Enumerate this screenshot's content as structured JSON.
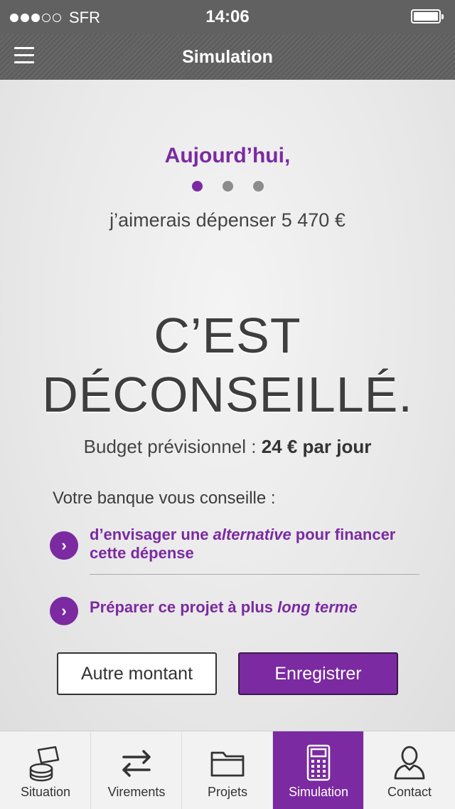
{
  "status_bar": {
    "carrier": "SFR",
    "time": "14:06"
  },
  "nav": {
    "title": "Simulation",
    "menu_icon": "hamburger-icon"
  },
  "simulation": {
    "heading": "Aujourd’hui,",
    "subtitle": "j’aimerais dépenser 5 470 €",
    "verdict_line1": "C’EST",
    "verdict_line2": "DÉCONSEILLÉ.",
    "budget_label": "Budget prévisionnel :",
    "budget_value": "24 € par jour",
    "advice_label": "Votre banque vous conseille :",
    "advice": [
      {
        "part1": "d’envisager une ",
        "italic": "alternative",
        "part2": " pour financer cette dépense"
      },
      {
        "part1": "Préparer ce projet à plus ",
        "italic": "long terme",
        "part2": ""
      }
    ],
    "buttons": {
      "other_amount": "Autre montant",
      "save": "Enregistrer"
    }
  },
  "tabs": [
    {
      "label": "Situation",
      "icon": "coins-card-icon",
      "active": false
    },
    {
      "label": "Virements",
      "icon": "transfer-arrows-icon",
      "active": false
    },
    {
      "label": "Projets",
      "icon": "folder-icon",
      "active": false
    },
    {
      "label": "Simulation",
      "icon": "calculator-icon",
      "active": true
    },
    {
      "label": "Contact",
      "icon": "person-icon",
      "active": false
    }
  ],
  "colors": {
    "accent": "#7b2aa1",
    "navbar": "#616161",
    "text": "#444444"
  }
}
